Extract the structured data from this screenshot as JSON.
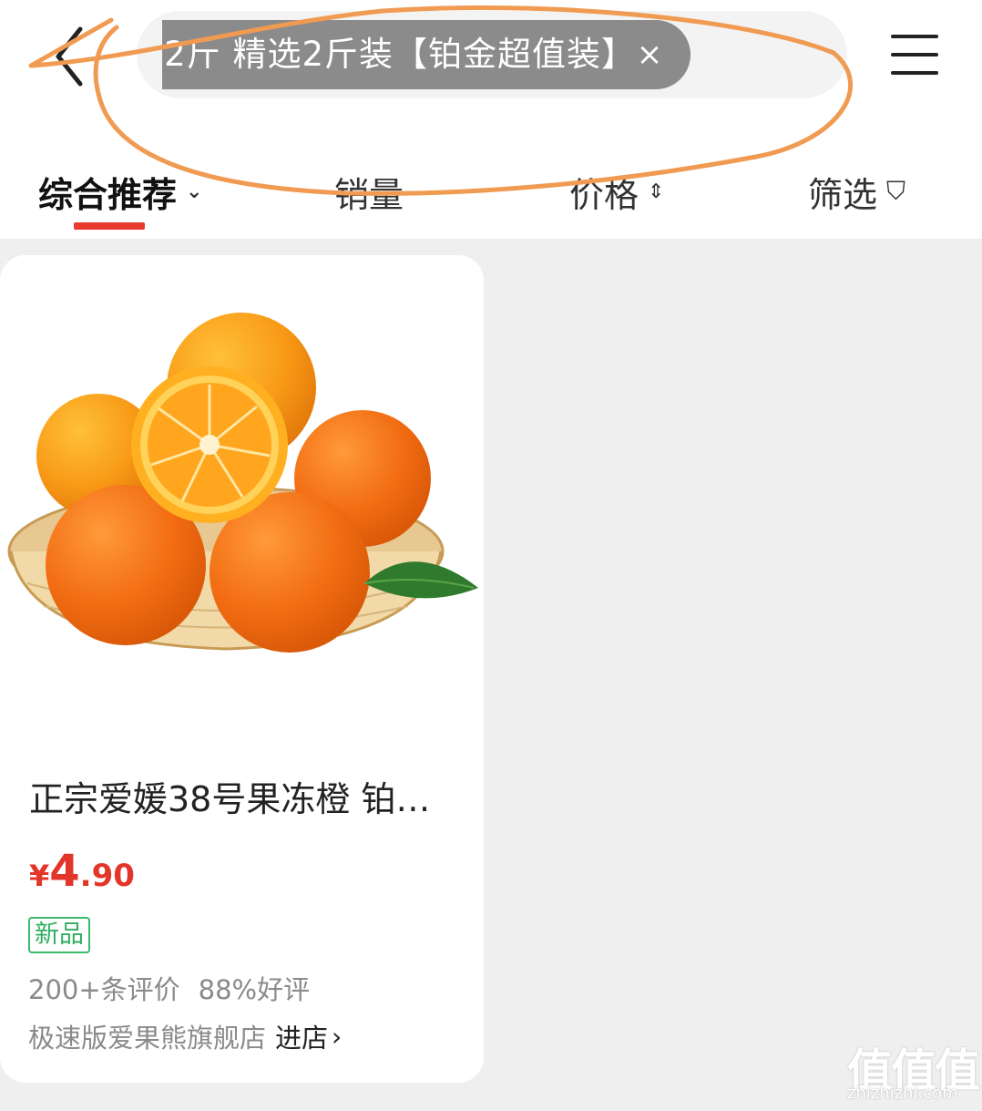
{
  "header": {
    "search_query": "2斤 精选2斤装【铂金超值装】",
    "clear_symbol": "×"
  },
  "tabs": [
    {
      "label": "综合推荐",
      "symbol": "⌄",
      "active": true
    },
    {
      "label": "销量",
      "symbol": "",
      "active": false
    },
    {
      "label": "价格",
      "symbol": "⇕",
      "active": false
    },
    {
      "label": "筛选",
      "symbol": "⛉",
      "active": false
    }
  ],
  "product": {
    "title": "正宗爱媛38号果冻橙 铂…",
    "price_currency": "¥",
    "price_integer": "4",
    "price_decimal": ".90",
    "badge": "新品",
    "reviews": "200+条评价",
    "rating": "88%好评",
    "shop_name": "极速版爱果熊旗舰店",
    "shop_link": "进店",
    "shop_link_symbol": "›"
  },
  "watermark": {
    "mark": "值值值",
    "url": "zhizhizhi.com"
  },
  "colors": {
    "accent": "#e83a2f",
    "price": "#e3362b",
    "badge_green": "#2fae5e",
    "annotation_orange": "#f09a52"
  }
}
